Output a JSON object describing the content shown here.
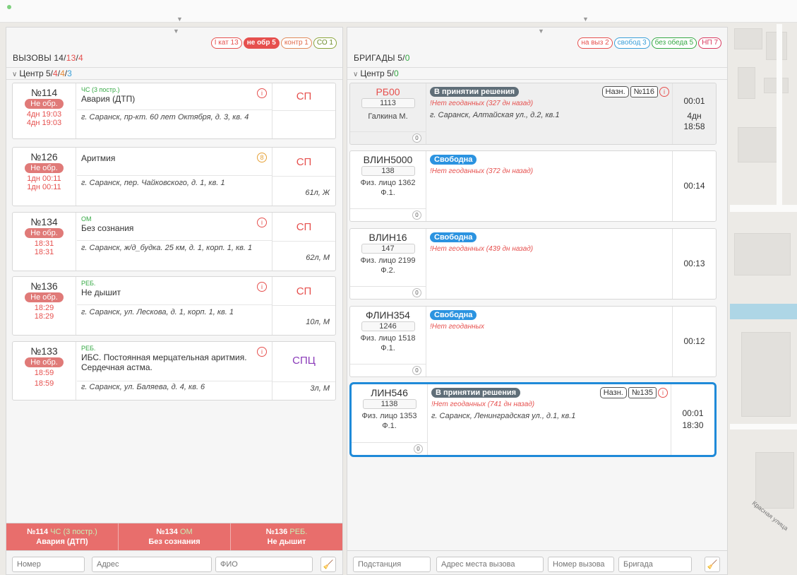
{
  "map": {
    "street_label": "Красная улица"
  },
  "calls": {
    "title_prefix": "ВЫЗОВЫ 14/",
    "title_a": "13",
    "title_sep": "/",
    "title_b": "4",
    "badges": [
      {
        "label": "I кат 13",
        "style": "b-red"
      },
      {
        "label": "не обр 5",
        "style": "b-red-fill"
      },
      {
        "label": "контр 1",
        "style": "b-orange"
      },
      {
        "label": "СО 1",
        "style": "b-olive"
      }
    ],
    "group": {
      "name": "Центр 5/",
      "a": "4",
      "sep1": "/",
      "b": "4",
      "sep2": "/",
      "c": "3"
    },
    "items": [
      {
        "num": "№114",
        "status": "Не обр.",
        "time1": "4дн 19:03",
        "time2": "4дн 19:03",
        "category": "ЧС (3 постр.)",
        "reason": "Авария (ДТП)",
        "address": "г. Саранск, пр-кт. 60 лет Октября, д. 3, кв. 4",
        "type": "СП",
        "patient": ""
      },
      {
        "num": "№126",
        "status": "Не обр.",
        "time1": "1дн 00:11",
        "time2": "1дн 00:11",
        "category": "",
        "reason": "Аритмия",
        "address": "г. Саранск, пер. Чайковского, д. 1, кв. 1",
        "type": "СП",
        "patient": "61л, Ж"
      },
      {
        "num": "№134",
        "status": "Не обр.",
        "time1": "18:31",
        "time2": "18:31",
        "category": "ОМ",
        "reason": "Без сознания",
        "address": "г. Саранск, ж/д_будка. 25 км, д. 1, корп. 1, кв. 1",
        "type": "СП",
        "patient": "62л, М"
      },
      {
        "num": "№136",
        "status": "Не обр.",
        "time1": "18:29",
        "time2": "18:29",
        "category": "РЕБ.",
        "reason": "Не дышит",
        "address": "г. Саранск, ул. Лескова, д. 1, корп. 1, кв. 1",
        "type": "СП",
        "patient": "10л, М"
      },
      {
        "num": "№133",
        "status": "Не обр.",
        "time1": "18:59",
        "time2": "18:59",
        "category": "РЕБ.",
        "reason": "ИБС. Постоянная мерцательная аритмия. Сердечная астма.",
        "address": "г. Саранск, ул. Баляева, д. 4, кв. 6",
        "type": "СПЦ",
        "patient": "3л, М"
      }
    ],
    "info_icon": "i",
    "info_icon_orange": "8",
    "alerts": [
      {
        "num": "№114",
        "cat": "ЧС (3 постр.)",
        "reason": "Авария (ДТП)"
      },
      {
        "num": "№134",
        "cat": "ОМ",
        "reason": "Без сознания"
      },
      {
        "num": "№136",
        "cat": "РЕБ.",
        "reason": "Не дышит"
      }
    ],
    "filters": {
      "number": "Номер",
      "address": "Адрес",
      "fio": "ФИО"
    }
  },
  "crews": {
    "title_prefix": "БРИГАДЫ 5/",
    "title_a": "0",
    "badges": [
      {
        "label": "на выз 2",
        "style": "b-red"
      },
      {
        "label": "свобод 3",
        "style": "b-blue"
      },
      {
        "label": "без обеда 5",
        "style": "b-green"
      },
      {
        "label": "НП 7",
        "style": "b-pink"
      }
    ],
    "group": {
      "name": "Центр 5/",
      "a": "0"
    },
    "items": [
      {
        "name": "РБ00",
        "code": "1113",
        "person1": "Галкина М.",
        "person2": "",
        "count": "0",
        "status": "В принятии решения",
        "geo": "!Нет геоданных (327 дн назад)",
        "address": "г. Саранск, Алтайская ул., д.2, кв.1",
        "tag1": "Назн.",
        "tag2": "№116",
        "time1": "00:01",
        "time2": "4дн",
        "time3": "18:58"
      },
      {
        "name": "ВЛИН5000",
        "code": "138",
        "person1": "Физ. лицо 1362",
        "person2": "Ф.1.",
        "count": "0",
        "status": "Свободна",
        "geo": "!Нет геоданных (372 дн назад)",
        "address": "",
        "tag1": "",
        "tag2": "",
        "time1": "00:14",
        "time2": "",
        "time3": ""
      },
      {
        "name": "ВЛИН16",
        "code": "147",
        "person1": "Физ. лицо 2199",
        "person2": "Ф.2.",
        "count": "0",
        "status": "Свободна",
        "geo": "!Нет геоданных (439 дн назад)",
        "address": "",
        "tag1": "",
        "tag2": "",
        "time1": "00:13",
        "time2": "",
        "time3": ""
      },
      {
        "name": "ФЛИН354",
        "code": "1246",
        "person1": "Физ. лицо 1518",
        "person2": "Ф.1.",
        "count": "0",
        "status": "Свободна",
        "geo": "!Нет геоданных",
        "address": "",
        "tag1": "",
        "tag2": "",
        "time1": "00:12",
        "time2": "",
        "time3": ""
      },
      {
        "name": "ЛИН546",
        "code": "1138",
        "person1": "Физ. лицо 1353",
        "person2": "Ф.1.",
        "count": "0",
        "status": "В принятии решения",
        "geo": "!Нет геоданных (741 дн назад)",
        "address": "г. Саранск, Ленинградская ул., д.1, кв.1",
        "tag1": "Назн.",
        "tag2": "№135",
        "time1": "00:01",
        "time2": "18:30",
        "time3": ""
      }
    ],
    "filters": {
      "substation": "Подстанция",
      "call_address": "Адрес места вызова",
      "call_number": "Номер вызова",
      "crew": "Бригада"
    }
  }
}
